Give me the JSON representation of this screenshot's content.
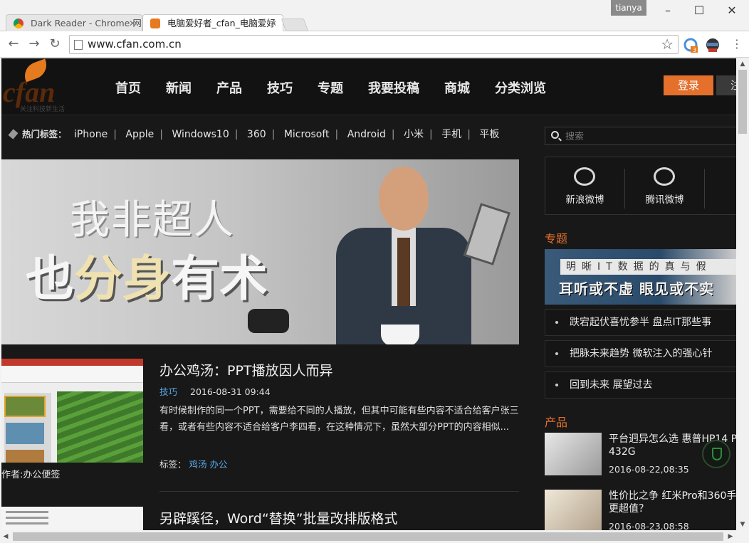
{
  "browser": {
    "tabs": [
      {
        "title": "Dark Reader - Chrome 网",
        "active": false
      },
      {
        "title": "电脑爱好者_cfan_电脑爱好",
        "active": true
      }
    ],
    "user": "tianya",
    "url": "www.cfan.com.cn",
    "ext_badge": "3"
  },
  "site": {
    "nav": [
      "首页",
      "新闻",
      "产品",
      "技巧",
      "专题",
      "我要投稿",
      "商城",
      "分类浏览"
    ],
    "login": "登录",
    "register": "注",
    "hot_label": "热门标签：",
    "hot_tags": [
      "iPhone",
      "Apple",
      "Windows10",
      "360",
      "Microsoft",
      "Android",
      "小米",
      "手机",
      "平板"
    ],
    "banner": {
      "line1": "我非超人",
      "line2_a": "也",
      "line2_b": "分身",
      "line2_c": "有术"
    }
  },
  "articles": [
    {
      "title": "办公鸡汤：PPT播放因人而异",
      "category": "技巧",
      "date": "2016-08-31 09:44",
      "excerpt": "有时候制作的同一个PPT，需要给不同的人播放，但其中可能有些内容不适合给客户张三看，或者有些内容不适合给客户李四看，在这种情况下，虽然大部分PPT的内容相似...",
      "tags_label": "标签：",
      "tags": [
        "鸡汤",
        "办公"
      ],
      "caption": "作者:办公便签"
    },
    {
      "title": "另辟蹊径，Word“替换”批量改排版格式"
    }
  ],
  "sidebar": {
    "search_placeholder": "搜索",
    "social": [
      "新浪微博",
      "腾讯微博"
    ],
    "topics_title": "专题",
    "topic_banner": {
      "strip": "明晰IT数据的真与假",
      "big": "耳听或不虚 眼见或不实"
    },
    "topics": [
      "跌宕起伏喜忧参半 盘点IT那些事",
      "把脉未来趋势 微软注入的强心针",
      "回到未来 展望过去"
    ],
    "products_title": "产品",
    "products": [
      {
        "title": "平台迥异怎么选 惠普HP14 P 432G",
        "date": "2016-08-22,08:35"
      },
      {
        "title": "性价比之争 红米Pro和360手 更超值？",
        "date": "2016-08-23,08:58"
      }
    ]
  }
}
